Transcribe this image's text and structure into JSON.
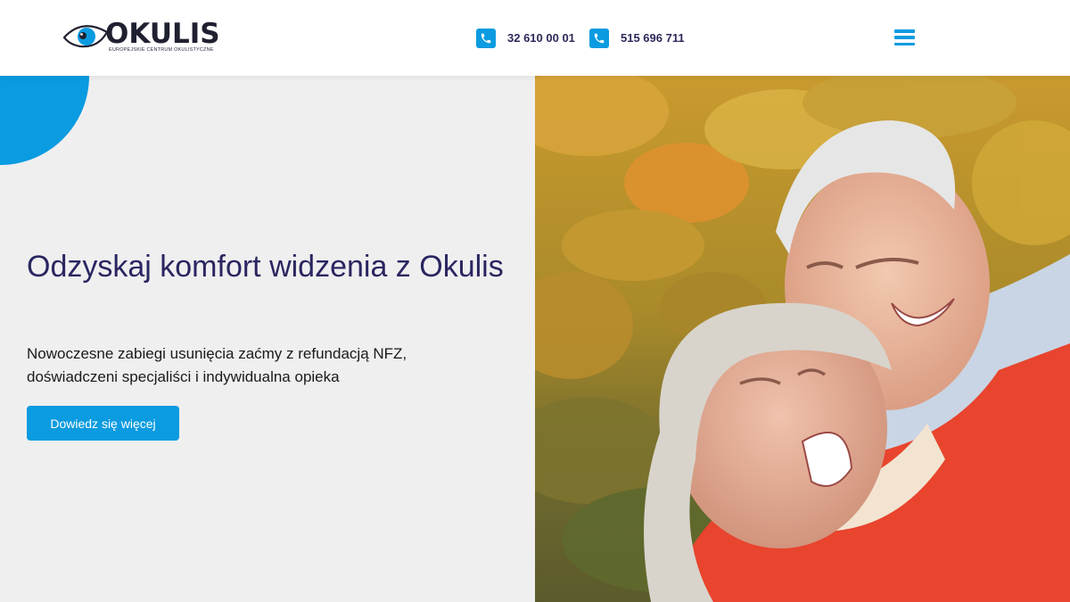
{
  "brand": {
    "name": "OKULIS",
    "tagline": "EUROPEJSKIE CENTRUM OKULISTYCZNE",
    "accent": "#0a9be0",
    "text_dark": "#2a2660"
  },
  "header": {
    "phones": [
      {
        "icon": "phone-icon",
        "number": "32 610 00 01"
      },
      {
        "icon": "phone-icon",
        "number": "515 696 711"
      }
    ],
    "menu_icon": "hamburger-menu-icon"
  },
  "hero": {
    "title": "Odzyskaj komfort widzenia z Okulis",
    "subtitle": "Nowoczesne zabiegi usunięcia zaćmy z refundacją NFZ, doświadczeni specjaliści i indywidualna opieka",
    "cta_label": "Dowiedz się więcej"
  }
}
